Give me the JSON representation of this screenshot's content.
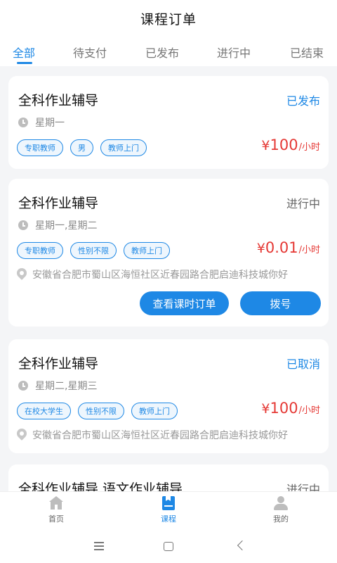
{
  "header": {
    "title": "课程订单"
  },
  "tabs": [
    {
      "label": "全部"
    },
    {
      "label": "待支付"
    },
    {
      "label": "已发布"
    },
    {
      "label": "进行中"
    },
    {
      "label": "已结束"
    }
  ],
  "orders": [
    {
      "title": "全科作业辅导",
      "status": "已发布",
      "schedule": "星期一",
      "tags": [
        "专职教师",
        "男",
        "教师上门"
      ],
      "price_currency": "¥",
      "price_amount": "100",
      "price_unit": "/小时"
    },
    {
      "title": "全科作业辅导",
      "status": "进行中",
      "schedule": "星期一,星期二",
      "tags": [
        "专职教师",
        "性别不限",
        "教师上门"
      ],
      "price_currency": "¥",
      "price_amount": "0.01",
      "price_unit": "/小时",
      "address": "安徽省合肥市蜀山区海恒社区近春园路合肥启迪科技城你好",
      "actions": [
        "查看课时订单",
        "拨号"
      ]
    },
    {
      "title": "全科作业辅导",
      "status": "已取消",
      "schedule": "星期二,星期三",
      "tags": [
        "在校大学生",
        "性别不限",
        "教师上门"
      ],
      "price_currency": "¥",
      "price_amount": "100",
      "price_unit": "/小时",
      "address": "安徽省合肥市蜀山区海恒社区近春园路合肥启迪科技城你好"
    },
    {
      "title": "全科作业辅导,语文作业辅导",
      "status": "进行中"
    }
  ],
  "bottom_nav": [
    {
      "label": "首页",
      "icon": "home-icon"
    },
    {
      "label": "课程",
      "icon": "course-icon"
    },
    {
      "label": "我的",
      "icon": "profile-icon"
    }
  ],
  "colors": {
    "accent": "#1e88e5",
    "price": "#e53935"
  }
}
